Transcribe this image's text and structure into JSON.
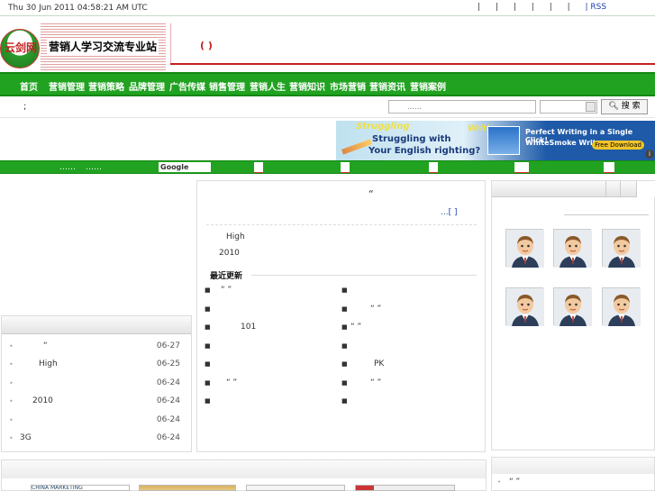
{
  "topbar": {
    "timestamp": "Thu 30 Jun 2011 04:58:21 AM UTC",
    "separators": [
      "|",
      "|",
      "|",
      "|",
      "|",
      "|",
      "|"
    ],
    "rss": "| RSS"
  },
  "header": {
    "logo_text": "云剑网",
    "slogan": "营销人学习交流专业站",
    "brackets": "(    )"
  },
  "nav": {
    "items": [
      "首页",
      "营销管理",
      "营销策略",
      "品牌管理",
      "广告传媒",
      "销售管理",
      "营销人生",
      "营销知识",
      "市场营销",
      "营销资讯",
      "营销案例"
    ],
    "accent": "#21a321"
  },
  "search": {
    "label": ";",
    "placeholder": "……",
    "button": "搜 索"
  },
  "banner": {
    "line1": "Struggling",
    "line2": "Writing",
    "line3": "Struggling with",
    "line4": "Your English righting?",
    "line5": "Perfect Writing in a Single Click!",
    "line6": "WhiteSmoke Writer",
    "download": "Free Download",
    "info": "i"
  },
  "greenstrip": {
    "dots1": "……",
    "dots2": "……",
    "google": "Google"
  },
  "left_list": [
    {
      "title": "“",
      "date": "06-27"
    },
    {
      "title": "High",
      "date": "06-25"
    },
    {
      "title": "",
      "date": "06-24"
    },
    {
      "title": "2010",
      "date": "06-24"
    },
    {
      "title": "",
      "date": "06-24"
    },
    {
      "title": "3G",
      "date": "06-24"
    }
  ],
  "middle": {
    "quote": "“",
    "more": "...[  ]",
    "line1": "High",
    "line2": "2010",
    "latest_title": "最近更新",
    "latest_left": [
      "“ ”",
      "",
      "101",
      "",
      "",
      "“  ”",
      ""
    ],
    "latest_right": [
      "",
      "“  ”",
      "“  ”",
      "",
      "PK",
      "“  ”",
      ""
    ]
  },
  "bottom_right": {
    "item": "“ ”"
  },
  "bottom_thumbs": [
    "CHINA MARKETING",
    "",
    "",
    ""
  ]
}
